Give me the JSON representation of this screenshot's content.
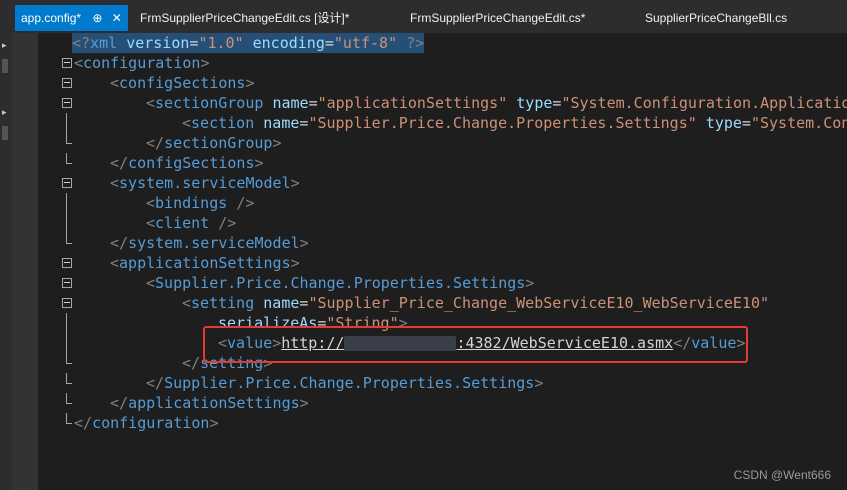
{
  "tabs": [
    {
      "label": "app.config*",
      "pin": "⊕",
      "close": "✕",
      "active": true
    },
    {
      "label": "FrmSupplierPriceChangeEdit.cs [设计]*",
      "active": false
    },
    {
      "label": "FrmSupplierPriceChangeEdit.cs*",
      "active": false
    },
    {
      "label": "SupplierPriceChangeBll.cs",
      "active": false
    }
  ],
  "code": {
    "xml_decl": {
      "open": "<?",
      "name": "xml",
      "a1": "version",
      "v1": "\"1.0\"",
      "a2": "encoding",
      "v2": "\"utf-8\"",
      "close": "?>"
    },
    "configuration": "configuration",
    "configSections": "configSections",
    "sectionGroup": {
      "tag": "sectionGroup",
      "a1": "name",
      "v1": "\"applicationSettings\"",
      "a2": "type",
      "v2": "\"System.Configuration.Applicatio"
    },
    "section": {
      "tag": "section",
      "a1": "name",
      "v1": "\"Supplier.Price.Change.Properties.Settings\"",
      "a2": "type",
      "v2": "\"System.Con"
    },
    "system_serviceModel": "system.serviceModel",
    "bindings": "bindings",
    "client": "client",
    "applicationSettings": "applicationSettings",
    "settings_group": "Supplier.Price.Change.Properties.Settings",
    "setting": {
      "tag": "setting",
      "a1": "name",
      "v1": "\"Supplier_Price_Change_WebServiceE10_WebServiceE10\"",
      "a2": "serializeAs",
      "v2": "\"String\""
    },
    "value": {
      "tag": "value",
      "url_prefix": "http://",
      "url_suffix": ":4382/WebServiceE10.asmx"
    }
  },
  "watermark": "CSDN @Went666",
  "colors": {
    "accent": "#007acc",
    "highlight_box": "#e53935",
    "xml_tag": "#569cd6",
    "xml_attr": "#9cdcfe",
    "xml_string": "#ce9178"
  }
}
